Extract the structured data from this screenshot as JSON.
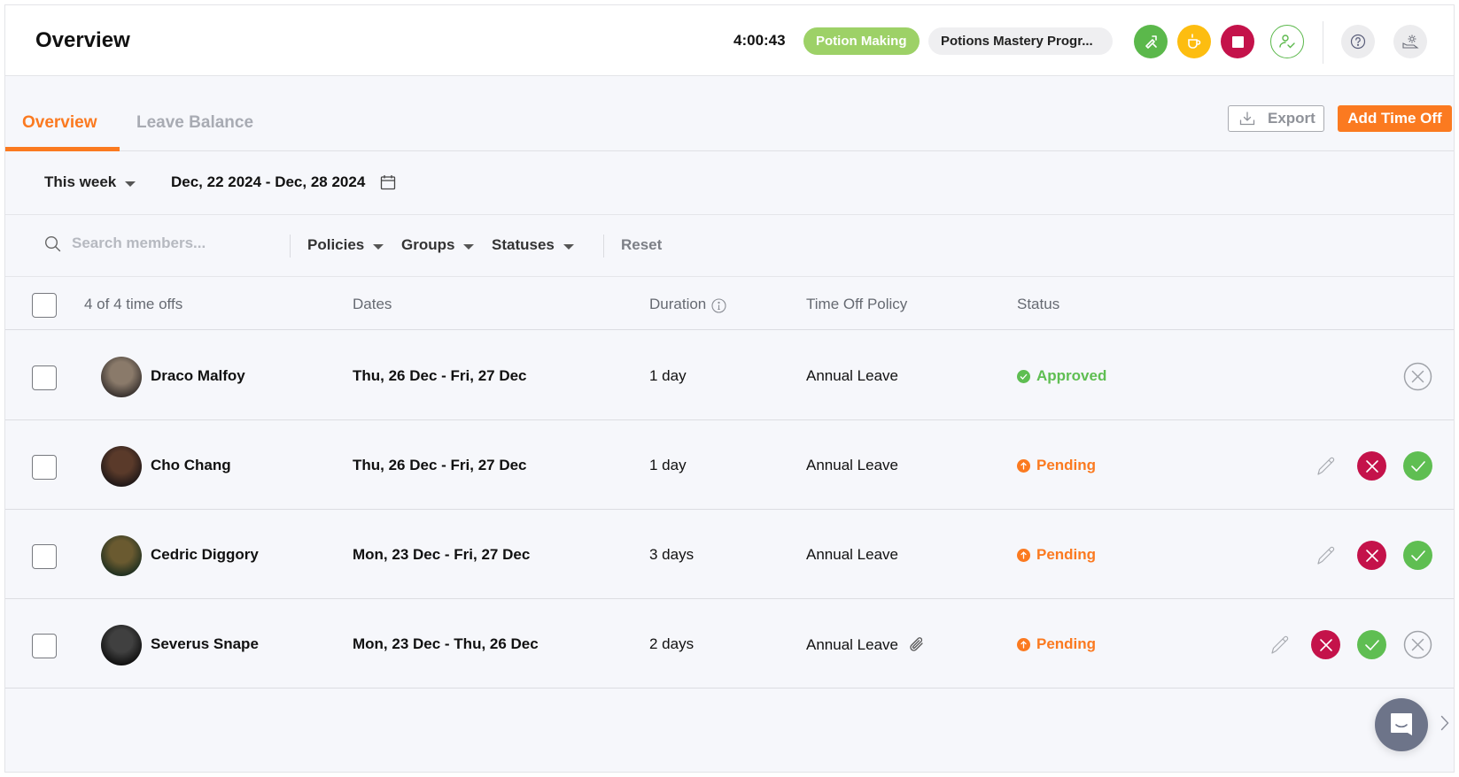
{
  "header": {
    "title": "Overview",
    "timer": "4:00:43",
    "project": "Potion Making",
    "task": "Potions Mastery Progr...",
    "icons": [
      "switch-task-icon",
      "break-coffee-icon",
      "stop-icon",
      "user-check-icon",
      "help-icon",
      "settings-icon"
    ]
  },
  "tabs": [
    {
      "label": "Overview",
      "active": true
    },
    {
      "label": "Leave Balance",
      "active": false
    }
  ],
  "actions": {
    "export_label": "Export",
    "add_label": "Add Time Off"
  },
  "range": {
    "period": "This week",
    "dates": "Dec, 22 2024 - Dec, 28 2024"
  },
  "filters": {
    "search_placeholder": "Search members...",
    "policies": "Policies",
    "groups": "Groups",
    "statuses": "Statuses",
    "reset": "Reset"
  },
  "table": {
    "count_label": "4 of 4 time offs",
    "columns": {
      "dates": "Dates",
      "duration": "Duration",
      "policy": "Time Off Policy",
      "status": "Status"
    },
    "rows": [
      {
        "name": "Draco Malfoy",
        "dates": "Thu, 26 Dec - Fri, 27 Dec",
        "duration": "1 day",
        "policy": "Annual Leave",
        "status": "Approved",
        "attachment": false,
        "actions": [
          "cancel"
        ]
      },
      {
        "name": "Cho Chang",
        "dates": "Thu, 26 Dec - Fri, 27 Dec",
        "duration": "1 day",
        "policy": "Annual Leave",
        "status": "Pending",
        "attachment": false,
        "actions": [
          "edit",
          "deny",
          "approve"
        ]
      },
      {
        "name": "Cedric Diggory",
        "dates": "Mon, 23 Dec - Fri, 27 Dec",
        "duration": "3 days",
        "policy": "Annual Leave",
        "status": "Pending",
        "attachment": false,
        "actions": [
          "edit",
          "deny",
          "approve"
        ]
      },
      {
        "name": "Severus Snape",
        "dates": "Mon, 23 Dec - Thu, 26 Dec",
        "duration": "2 days",
        "policy": "Annual Leave",
        "status": "Pending",
        "attachment": true,
        "actions": [
          "edit",
          "deny",
          "approve",
          "cancel"
        ]
      }
    ]
  },
  "colors": {
    "accent": "#fb7a20",
    "approved": "#5fbe52",
    "pending": "#fb7a20",
    "deny": "#c4124a",
    "project_pill": "#9dd167"
  }
}
